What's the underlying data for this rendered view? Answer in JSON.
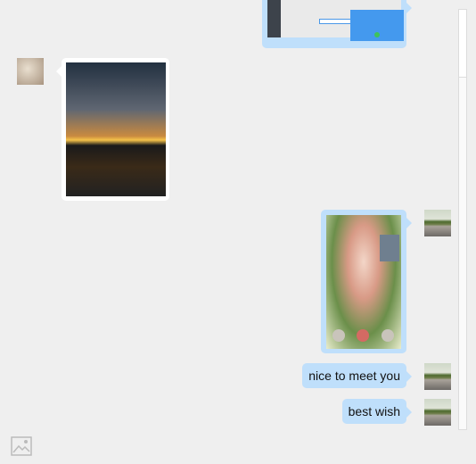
{
  "messages": [
    {
      "side": "right",
      "type": "image",
      "description_icon": "screenshot-image"
    },
    {
      "side": "left",
      "type": "image",
      "description_icon": "sunset-photo"
    },
    {
      "side": "right",
      "type": "image",
      "description_icon": "video-call-screenshot"
    },
    {
      "side": "right",
      "type": "text",
      "text": "nice  to meet you"
    },
    {
      "side": "right",
      "type": "text",
      "text": "best wish"
    }
  ],
  "colors": {
    "background": "#efefef",
    "outgoing_bubble": "#bfdffb",
    "incoming_bubble": "#ffffff"
  },
  "toolbar": {
    "image_button_icon": "image-icon"
  }
}
